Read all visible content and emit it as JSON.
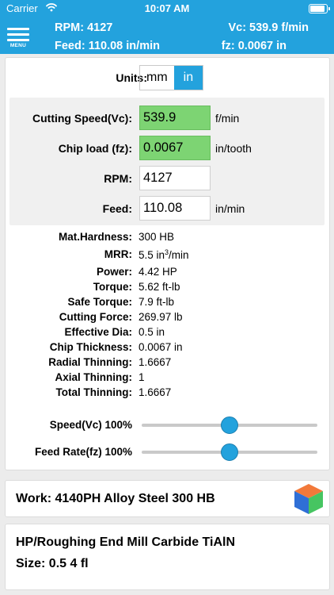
{
  "status_bar": {
    "carrier": "Carrier",
    "time": "10:07 AM"
  },
  "header": {
    "menu_label": "MENU",
    "rpm": "RPM: 4127",
    "feed": "Feed: 110.08 in/min",
    "vc": "Vc: 539.9 f/min",
    "fz": "fz: 0.0067 in"
  },
  "units": {
    "label": "Units:",
    "options": [
      "mm",
      "in"
    ],
    "selected": "in"
  },
  "inputs": {
    "cutting_speed": {
      "label": "Cutting Speed(Vc):",
      "value": "539.9",
      "unit": "f/min"
    },
    "chip_load": {
      "label": "Chip load (fz):",
      "value": "0.0067",
      "unit": "in/tooth"
    },
    "rpm": {
      "label": "RPM:",
      "value": "4127"
    },
    "feed": {
      "label": "Feed:",
      "value": "110.08",
      "unit": "in/min"
    }
  },
  "stats": [
    {
      "label": "Mat.Hardness:",
      "value": "300  HB"
    },
    {
      "label": "MRR:",
      "value": "5.5  in",
      "sup": "3",
      "suffix": "/min"
    },
    {
      "label": "Power:",
      "value": "4.42  HP"
    },
    {
      "label": "Torque:",
      "value": "5.62  ft-lb"
    },
    {
      "label": "Safe Torque:",
      "value": "7.9  ft-lb"
    },
    {
      "label": "Cutting Force:",
      "value": "269.97  lb"
    },
    {
      "label": "Effective Dia:",
      "value": "0.5  in"
    },
    {
      "label": "Chip Thickness:",
      "value": "0.0067  in"
    },
    {
      "label": "Radial Thinning:",
      "value": "1.6667"
    },
    {
      "label": "Axial Thinning:",
      "value": "1"
    },
    {
      "label": "Total Thinning:",
      "value": "1.6667"
    }
  ],
  "sliders": {
    "speed": {
      "label": "Speed(Vc) 100%",
      "level": 0.5
    },
    "feed_rate": {
      "label": "Feed Rate(fz) 100%",
      "level": 0.5
    }
  },
  "work": {
    "label": "Work: 4140PH Alloy Steel 300 HB",
    "icon": "material-cube-icon"
  },
  "tool": {
    "line1": "HP/Roughing End Mill Carbide TiAlN",
    "line2": "Size: 0.5 4 fl"
  },
  "colors": {
    "accent": "#23a2dd",
    "highlight": "#7dd473"
  }
}
